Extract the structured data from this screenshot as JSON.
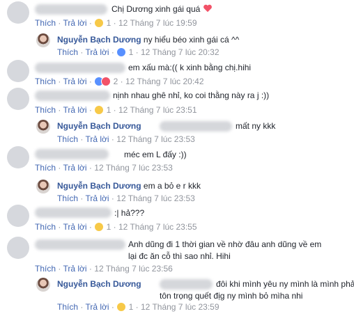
{
  "actions": {
    "like": "Thích",
    "reply": "Trả lời",
    "separator": "·"
  },
  "comments": [
    {
      "kind": "top",
      "author": "",
      "text": "Chị Dương xinh gái quá",
      "trail": "heart",
      "reaction": "haha",
      "count": "1",
      "time": "12 Tháng 7 lúc 19:59"
    },
    {
      "kind": "reply",
      "author": "Nguyễn Bạch Dương",
      "tag_blurred": false,
      "text": "ny hiểu béo xinh gái cá ^^",
      "reaction": "like",
      "count": "1",
      "time": "12 Tháng 7 lúc 20:32"
    },
    {
      "kind": "top",
      "author": "",
      "text": "em xấu mà:(( k xinh bằng chị.hihi",
      "reaction": "like-love",
      "count": "2",
      "time": "12 Tháng 7 lúc 20:42"
    },
    {
      "kind": "top",
      "author": "",
      "text": "nịnh nhau ghê nhỉ, ko coi thằng này ra j :))",
      "reaction": "haha",
      "count": "1",
      "time": "12 Tháng 7 lúc 23:51"
    },
    {
      "kind": "reply",
      "author": "Nguyễn Bạch Dương",
      "tag_blurred": true,
      "text": "mất ny kkk",
      "reaction": "",
      "count": "",
      "time": "12 Tháng 7 lúc 23:53"
    },
    {
      "kind": "top",
      "author": "",
      "text": "méc em L đấy :))",
      "reaction": "",
      "count": "",
      "time": "12 Tháng 7 lúc 23:53"
    },
    {
      "kind": "reply",
      "author": "Nguyễn Bạch Dương",
      "tag_blurred": false,
      "text": "em a bỏ e r kkk",
      "reaction": "",
      "count": "",
      "time": "12 Tháng 7 lúc 23:53"
    },
    {
      "kind": "top",
      "author": "",
      "text": ":| hả???",
      "reaction": "haha",
      "count": "1",
      "time": "12 Tháng 7 lúc 23:55"
    },
    {
      "kind": "top",
      "author": "",
      "text": "Anh dũng đi 1 thời gian về nhờ đâu anh dũng về em",
      "text2": "lại đc ăn cỗ thì sao nhỉ. Hihi",
      "reaction": "",
      "count": "",
      "time": "12 Tháng 7 lúc 23:56"
    },
    {
      "kind": "reply",
      "author": "Nguyễn Bạch Dương",
      "tag_blurred": true,
      "text": "đôi khi mình yêu ny mình là mình phải",
      "text2": "tôn trọng quết địg ny mình bỏ mìha nhi",
      "reaction": "haha",
      "count": "1",
      "time": "12 Tháng 7 lúc 23:59"
    }
  ],
  "colors": {
    "link": "#4267b2",
    "name": "#365899",
    "meta": "#90949c",
    "heart": "#f25268"
  }
}
